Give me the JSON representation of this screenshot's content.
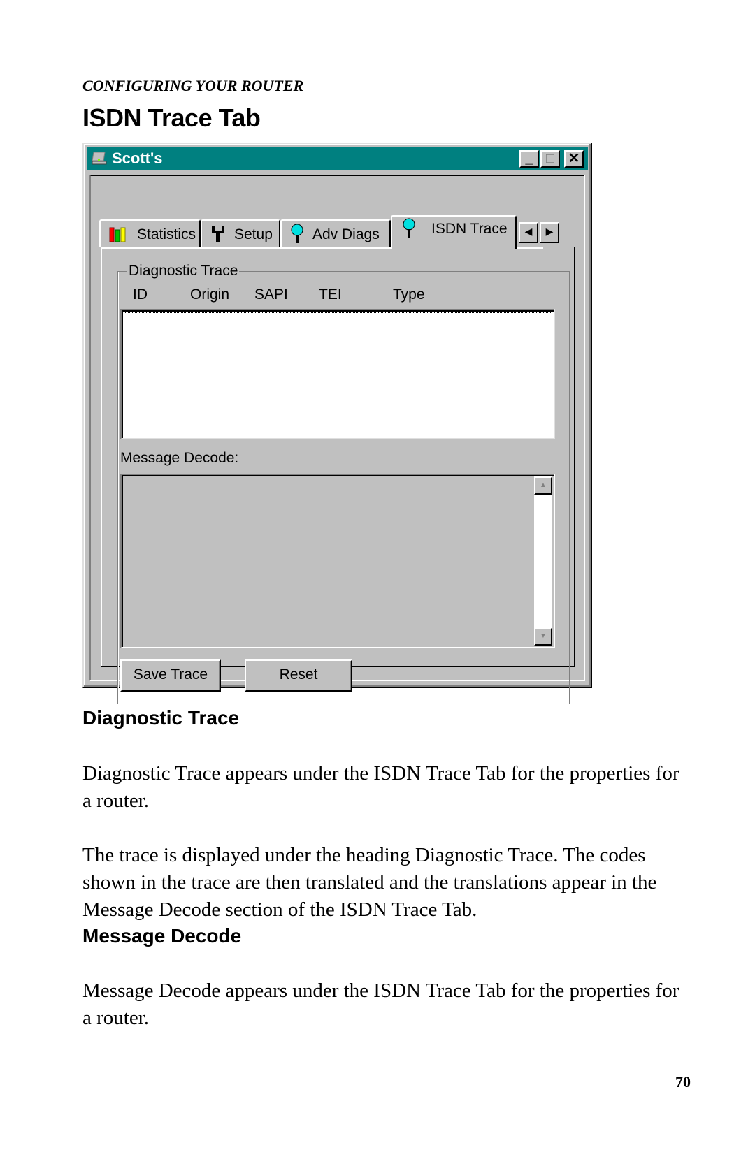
{
  "page": {
    "running_head": "CONFIGURING YOUR ROUTER",
    "title": "ISDN Trace Tab",
    "page_number": "70"
  },
  "window": {
    "title": "Scott's",
    "title_icon": "computer-icon",
    "controls": {
      "minimize": "_",
      "maximize": "□",
      "close": "✕"
    },
    "titlebar_color": "#008080",
    "tabs": [
      {
        "label": "Statistics",
        "icon": "bar-chart-icon",
        "active": false
      },
      {
        "label": "Setup",
        "icon": "wrench-icon",
        "active": false
      },
      {
        "label": "Adv Diags",
        "icon": "probe-icon",
        "active": false
      },
      {
        "label": "ISDN Trace",
        "icon": "probe-icon",
        "active": true
      }
    ],
    "tab_scroll": {
      "left": "◀",
      "right": "▶"
    },
    "diagnostic_trace": {
      "group_label": "Diagnostic Trace",
      "columns": [
        "ID",
        "Origin",
        "SAPI",
        "TEI",
        "Type"
      ],
      "rows": []
    },
    "message_decode": {
      "label": "Message Decode:",
      "content": "",
      "scroll_up": "▲",
      "scroll_down": "▼"
    },
    "buttons": {
      "save_trace": "Save Trace",
      "reset": "Reset"
    }
  },
  "sections": [
    {
      "heading": "Diagnostic Trace",
      "paragraphs": [
        "Diagnostic Trace appears under the ISDN Trace Tab for the properties for a router.",
        "The trace is displayed under the heading Diagnostic Trace.  The codes shown in the trace are then translated and the translations appear in the Message Decode section of the ISDN Trace Tab."
      ]
    },
    {
      "heading": "Message Decode",
      "paragraphs": [
        "Message Decode appears under the ISDN Trace Tab for the properties for a router."
      ]
    }
  ]
}
